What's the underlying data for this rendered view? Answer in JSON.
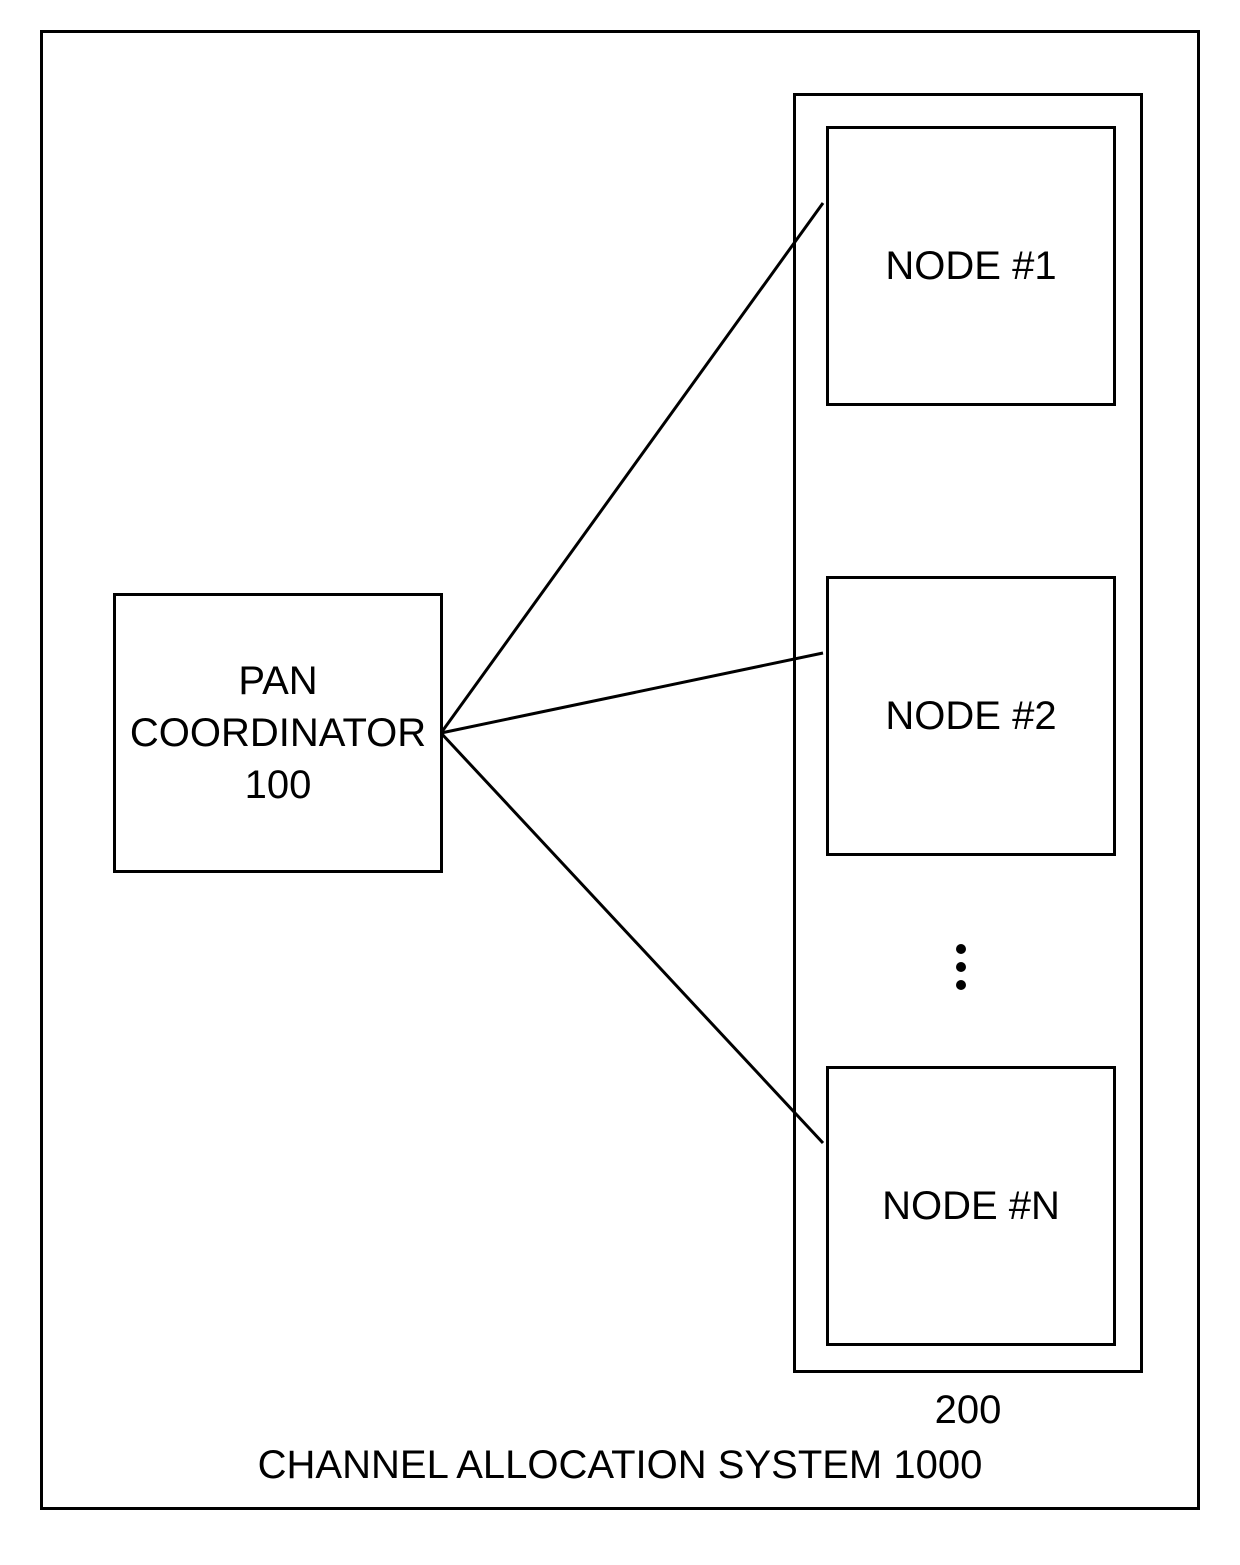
{
  "diagram": {
    "coordinator": {
      "label_line1": "PAN",
      "label_line2": "COORDINATOR",
      "number": "100"
    },
    "nodes_container": {
      "number": "200",
      "nodes": [
        {
          "label": "NODE #1"
        },
        {
          "label": "NODE #2"
        },
        {
          "label": "NODE #N"
        }
      ]
    },
    "caption": "CHANNEL ALLOCATION SYSTEM 1000"
  }
}
